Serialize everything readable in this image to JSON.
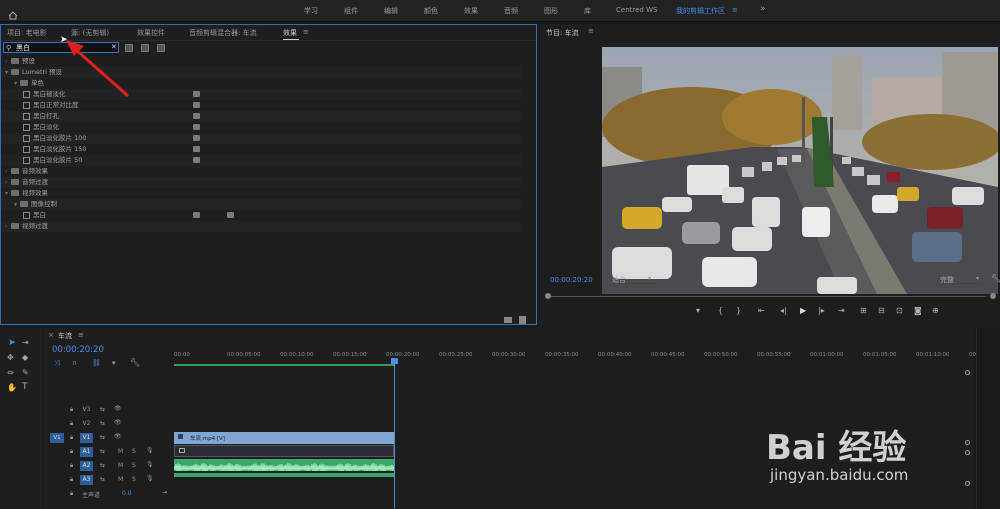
{
  "workspaces": {
    "home_icon": "home-icon",
    "items": [
      "学习",
      "组件",
      "编辑",
      "颜色",
      "效果",
      "音频",
      "图形",
      "库",
      "Centred WS"
    ],
    "active": "我的剪辑工作区",
    "more": "»"
  },
  "left_panel": {
    "tabs": [
      "项目: 老电影",
      "源: (无剪辑)",
      "效果控件",
      "音频剪辑混合器: 车流",
      "效果"
    ],
    "search_value": "黑白",
    "tree": [
      {
        "label": "预设",
        "level": 0,
        "type": "folder",
        "expanded": false
      },
      {
        "label": "Lumetri 预设",
        "level": 0,
        "type": "folder",
        "expanded": true
      },
      {
        "label": "单色",
        "level": 1,
        "type": "folder",
        "expanded": true
      },
      {
        "label": "黑白褪淡化",
        "level": 2,
        "type": "fx"
      },
      {
        "label": "黑白正常对比度",
        "level": 2,
        "type": "fx"
      },
      {
        "label": "黑白打孔",
        "level": 2,
        "type": "fx"
      },
      {
        "label": "黑白淡化",
        "level": 2,
        "type": "fx"
      },
      {
        "label": "黑白淡化胶片 100",
        "level": 2,
        "type": "fx"
      },
      {
        "label": "黑白淡化胶片 150",
        "level": 2,
        "type": "fx"
      },
      {
        "label": "黑白淡化胶片 50",
        "level": 2,
        "type": "fx"
      },
      {
        "label": "音频效果",
        "level": 0,
        "type": "folder",
        "expanded": false
      },
      {
        "label": "音频过渡",
        "level": 0,
        "type": "folder",
        "expanded": false
      },
      {
        "label": "视频效果",
        "level": 0,
        "type": "folder",
        "expanded": true
      },
      {
        "label": "图像控制",
        "level": 1,
        "type": "folder",
        "expanded": true
      },
      {
        "label": "黑白",
        "level": 2,
        "type": "fx"
      },
      {
        "label": "视频过渡",
        "level": 0,
        "type": "folder",
        "expanded": false
      }
    ]
  },
  "monitor": {
    "title": "节目: 车流",
    "timecode": "00:00:20:20",
    "fit": "适合",
    "quality": "完整"
  },
  "timeline": {
    "sequence": "车流",
    "timecode": "00:00:20:20",
    "ruler": [
      "00:00",
      "00:00:05:00",
      "00:00:10:00",
      "00:00:15:00",
      "00:00:20:00",
      "00:00:25:00",
      "00:00:30:00",
      "00:00:35:00",
      "00:00:40:00",
      "00:00:45:00",
      "00:00:50:00",
      "00:00:55:00",
      "00:01:00:00",
      "00:01:05:00",
      "00:01:10:00",
      "00:0"
    ],
    "tracks": [
      {
        "name": "V3",
        "kind": "video"
      },
      {
        "name": "V2",
        "kind": "video"
      },
      {
        "name": "V1",
        "kind": "video",
        "src": "V1"
      },
      {
        "name": "A1",
        "kind": "audio"
      },
      {
        "name": "A2",
        "kind": "audio"
      },
      {
        "name": "A3",
        "kind": "audio"
      }
    ],
    "master": {
      "label": "主声道",
      "value": "0.0"
    },
    "clip_name": "车流.mp4 [V]",
    "playhead_fraction": 0.26,
    "clip_end_fraction": 0.26
  },
  "watermark": {
    "text": "Bai 经验",
    "url": "jingyan.baidu.com"
  }
}
